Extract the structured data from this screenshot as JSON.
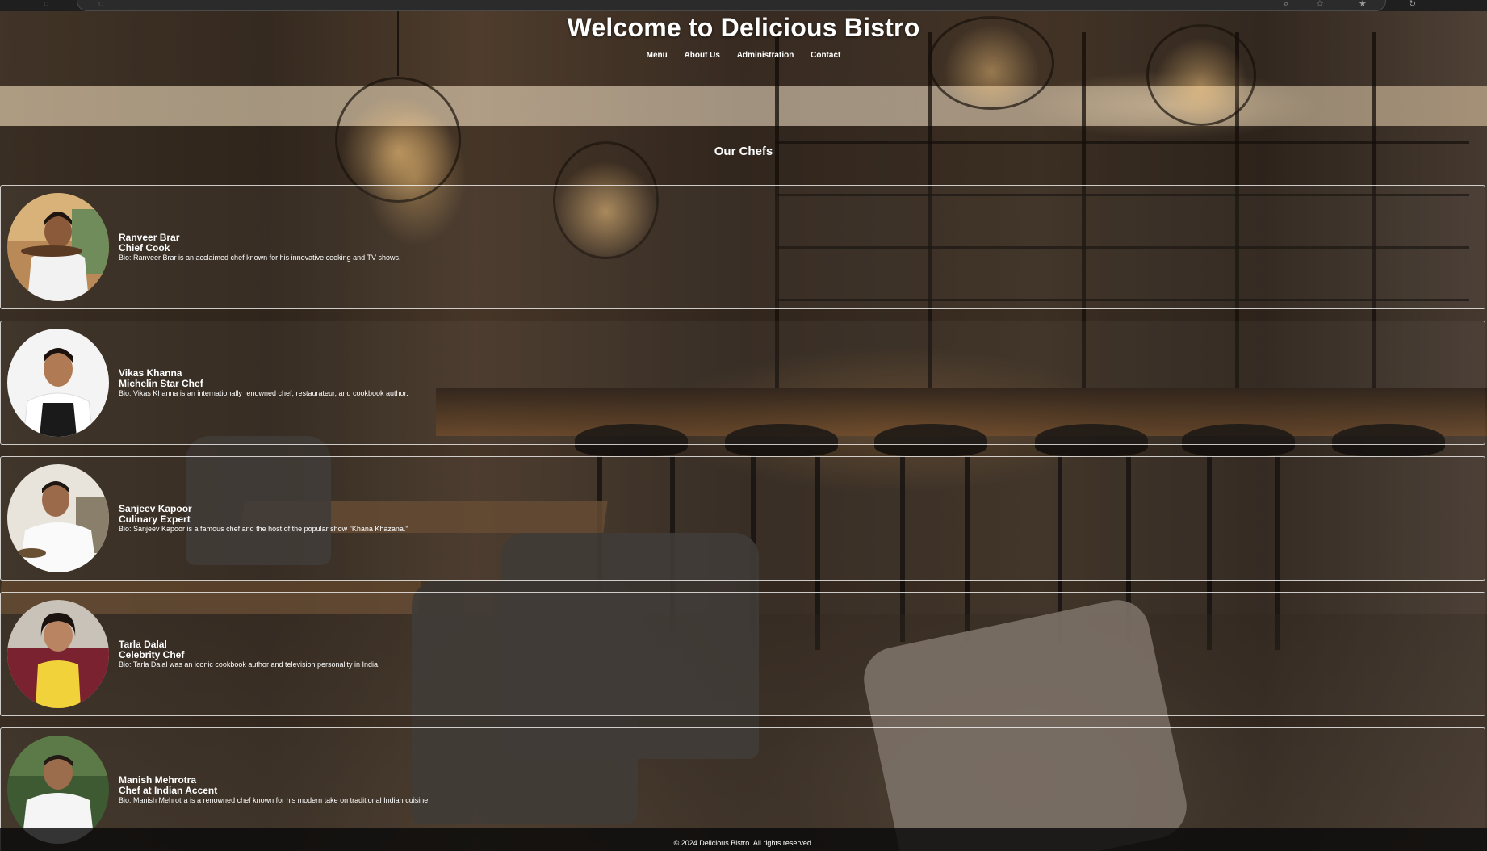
{
  "header": {
    "title": "Welcome to Delicious Bistro",
    "nav": [
      "Menu",
      "About Us",
      "Administration",
      "Contact"
    ]
  },
  "section": {
    "title": "Our Chefs"
  },
  "chefs": [
    {
      "name": "Ranveer Brar",
      "role": "Chief Cook",
      "bio": "Bio: Ranveer Brar is an acclaimed chef known for his innovative cooking and TV shows."
    },
    {
      "name": "Vikas Khanna",
      "role": "Michelin Star Chef",
      "bio": "Bio: Vikas Khanna is an internationally renowned chef, restaurateur, and cookbook author."
    },
    {
      "name": "Sanjeev Kapoor",
      "role": "Culinary Expert",
      "bio": "Bio: Sanjeev Kapoor is a famous chef and the host of the popular show \"Khana Khazana.\""
    },
    {
      "name": "Tarla Dalal",
      "role": "Celebrity Chef",
      "bio": "Bio: Tarla Dalal was an iconic cookbook author and television personality in India."
    },
    {
      "name": "Manish Mehrotra",
      "role": "Chef at Indian Accent",
      "bio": "Bio: Manish Mehrotra is a renowned chef known for his modern take on traditional Indian cuisine."
    }
  ],
  "footer": {
    "text": "© 2024 Delicious Bistro. All rights reserved."
  }
}
